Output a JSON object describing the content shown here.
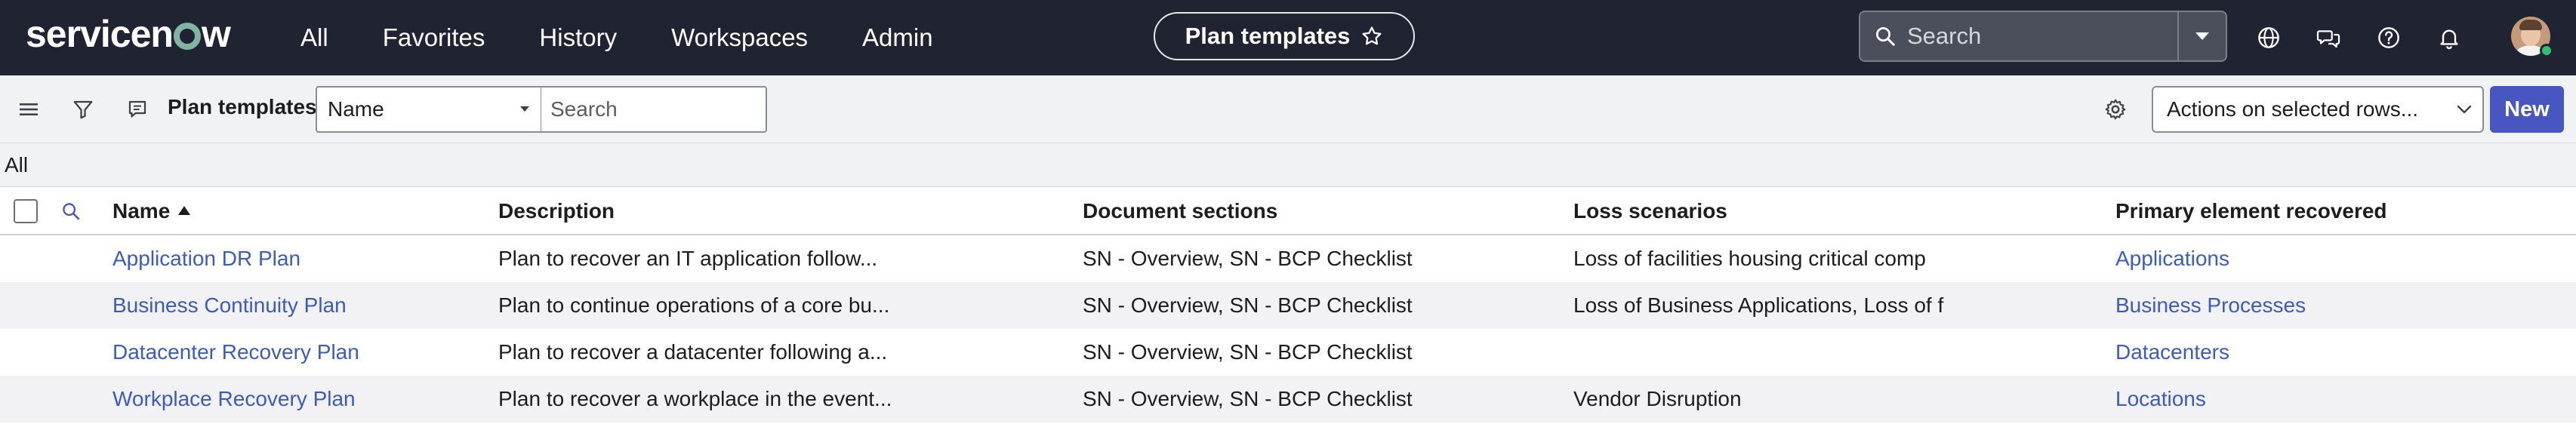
{
  "brand": {
    "logo_text_pre": "servicen",
    "logo_text_post": "w"
  },
  "nav": {
    "items": [
      "All",
      "Favorites",
      "History",
      "Workspaces",
      "Admin"
    ],
    "context_title": "Plan templates",
    "search_placeholder": "Search"
  },
  "icons": {
    "star": "star-outline-icon",
    "search": "search-icon",
    "scope": "chevron-down-icon",
    "globe": "globe-icon",
    "chat": "chat-bubbles-icon",
    "help": "help-circle-icon",
    "bell": "bell-icon"
  },
  "toolbar": {
    "list_title": "Plan templates",
    "field_value": "Name",
    "search_placeholder": "Search",
    "actions_value": "Actions on selected rows...",
    "new_label": "New"
  },
  "breadcrumb": {
    "label": "All"
  },
  "table": {
    "columns": [
      "Name",
      "Description",
      "Document sections",
      "Loss scenarios",
      "Primary element recovered"
    ],
    "rows": [
      {
        "name": "Application DR Plan",
        "description": "Plan to recover an IT application follow...",
        "sections": "SN - Overview, SN - BCP Checklist",
        "loss": "Loss of facilities housing critical comp",
        "element": "Applications"
      },
      {
        "name": "Business Continuity Plan",
        "description": "Plan to continue operations of a core bu...",
        "sections": "SN - Overview, SN - BCP Checklist",
        "loss": "Loss of Business Applications, Loss of f",
        "element": "Business Processes"
      },
      {
        "name": "Datacenter Recovery Plan",
        "description": "Plan to recover a datacenter following a...",
        "sections": "SN - Overview, SN - BCP Checklist",
        "loss": "",
        "element": "Datacenters"
      },
      {
        "name": "Workplace Recovery Plan",
        "description": "Plan to recover a workplace in the event...",
        "sections": "SN - Overview, SN - BCP Checklist",
        "loss": "Vendor Disruption",
        "element": "Locations"
      }
    ]
  },
  "colors": {
    "nav_bg": "#1f2332",
    "toolbar_bg": "#f1f2f4",
    "link": "#3b5bc4",
    "primary_button": "#4756c0",
    "logo_accent": "#81b5a1"
  }
}
